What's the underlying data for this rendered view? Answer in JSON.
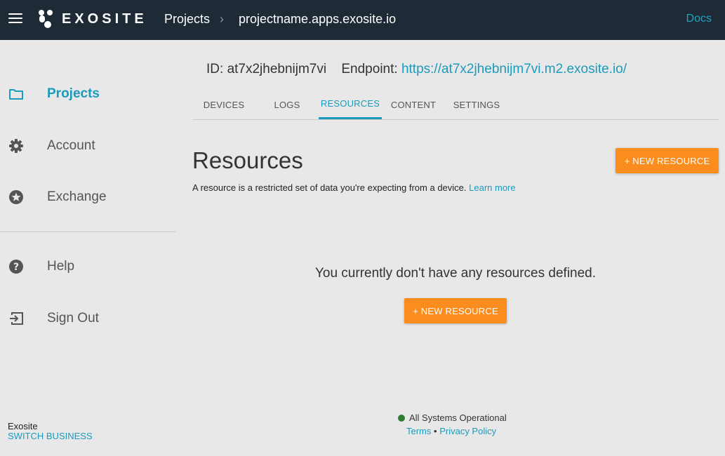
{
  "header": {
    "brand": "EXOSITE",
    "breadcrumb_projects": "Projects",
    "breadcrumb_sep": "›",
    "breadcrumb_project": "projectname.apps.exosite.io",
    "docs": "Docs"
  },
  "sidebar": {
    "items": [
      {
        "label": "Projects",
        "icon": "folder-icon"
      },
      {
        "label": "Account",
        "icon": "gear-icon"
      },
      {
        "label": "Exchange",
        "icon": "star-badge-icon"
      },
      {
        "label": "Help",
        "icon": "help-icon"
      },
      {
        "label": "Sign Out",
        "icon": "sign-out-icon"
      }
    ],
    "org_name": "Exosite",
    "switch_business": "SWITCH BUSINESS"
  },
  "project": {
    "id_label": "ID:",
    "id_value": "at7x2jhebnijm7vi",
    "endpoint_label": "Endpoint:",
    "endpoint_url": "https://at7x2jhebnijm7vi.m2.exosite.io/"
  },
  "tabs": [
    {
      "label": "DEVICES"
    },
    {
      "label": "LOGS"
    },
    {
      "label": "RESOURCES"
    },
    {
      "label": "CONTENT"
    },
    {
      "label": "SETTINGS"
    }
  ],
  "main": {
    "title": "Resources",
    "description": "A resource is a restricted set of data you're expecting from a device.",
    "learn_more": "Learn more",
    "new_resource": "+ NEW RESOURCE",
    "empty_message": "You currently don't have any resources defined."
  },
  "footer": {
    "status": "All Systems Operational",
    "terms": "Terms",
    "separator": "•",
    "privacy": "Privacy Policy"
  },
  "colors": {
    "topbar": "#1e2a36",
    "accent": "#1a9bbd",
    "button": "#fb8c1e",
    "status_ok": "#2e7d32"
  }
}
